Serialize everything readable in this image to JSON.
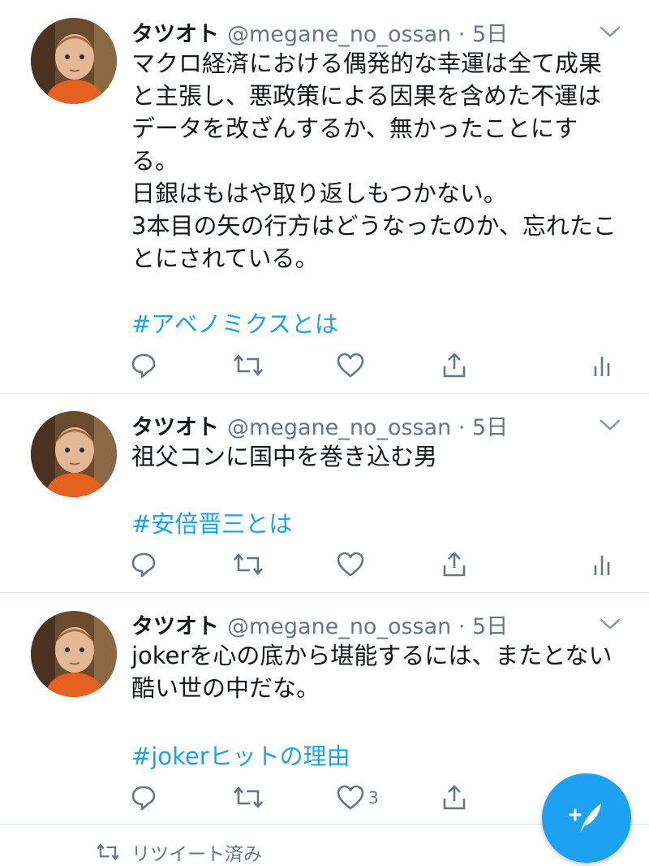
{
  "tweets": [
    {
      "name": "タツオト",
      "handle": "@megane_no_ossan · 5日",
      "text": "マクロ経済における偶発的な幸運は全て成果\nと主張し、悪政策による因果を含めた不運は\nデータを改ざんするか、無かったことにす\nる。\n日銀はもはや取り返しもつかない。\n3本目の矢の行方はどうなったのか、忘れたこ\nとにされている。",
      "hashtag": "#アベノミクスとは",
      "likes": ""
    },
    {
      "name": "タツオト",
      "handle": "@megane_no_ossan · 5日",
      "text": "祖父コンに国中を巻き込む男",
      "hashtag": "#安倍晋三とは",
      "likes": ""
    },
    {
      "name": "タツオト",
      "handle": "@megane_no_ossan · 5日",
      "text": "jokerを心の底から堪能するには、またとない\n酷い世の中だな。",
      "hashtag": "#jokerヒットの理由",
      "likes": "3"
    }
  ],
  "retweeted_label": "リツイート済み",
  "icons": {
    "reply": "reply-icon",
    "retweet": "retweet-icon",
    "like": "heart-icon",
    "share": "share-icon",
    "analytics": "analytics-icon",
    "menu": "chevron-down-icon",
    "compose": "compose-tweet-icon"
  },
  "colors": {
    "link": "#1da1f2",
    "secondary": "#657786",
    "divider": "#e1e8ed",
    "fab": "#1da1f2"
  }
}
